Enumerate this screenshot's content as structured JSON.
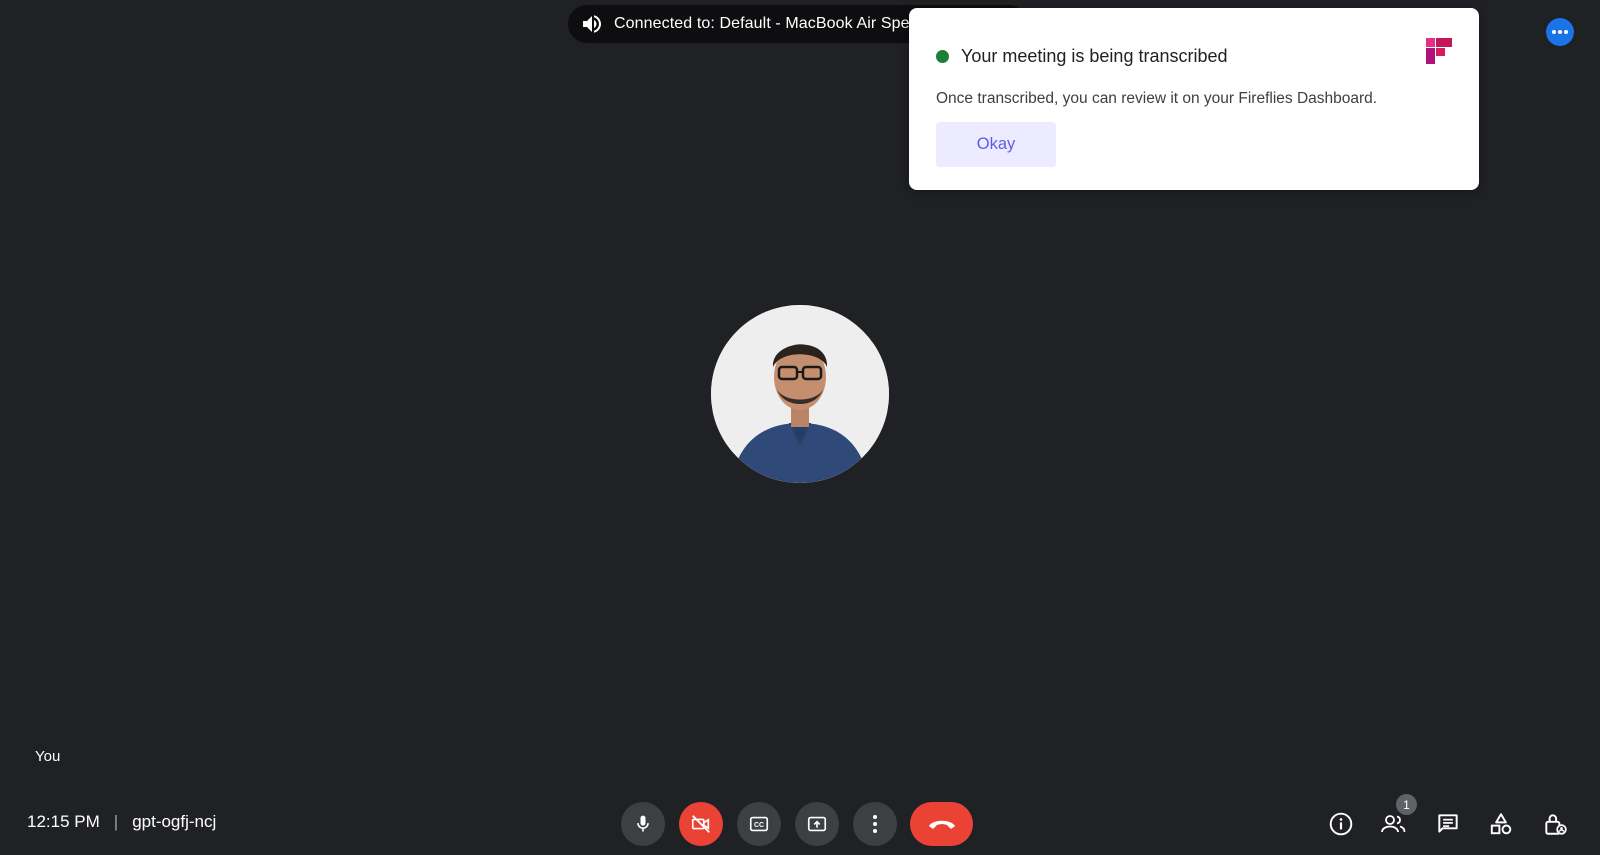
{
  "audio_banner": {
    "text": "Connected to: Default - MacBook Air Speakers"
  },
  "notification": {
    "title": "Your meeting is being transcribed",
    "body": "Once transcribed, you can review it on your Fireflies Dashboard.",
    "button_label": "Okay",
    "status_color": "#188038",
    "button_color": "#ecebff",
    "logo_icon": "fireflies-logo-icon"
  },
  "participant": {
    "label": "You",
    "avatar": "profile-photo"
  },
  "meeting": {
    "time": "12:15 PM",
    "separator": "|",
    "code": "gpt-ogfj-ncj"
  },
  "controls": {
    "mic": "microphone-icon",
    "camera": "camera-off-icon",
    "captions": "closed-captions-icon",
    "present": "present-screen-icon",
    "more": "more-vert-icon",
    "end": "end-call-icon"
  },
  "right_controls": {
    "people_count": "1"
  },
  "colors": {
    "background": "#202124",
    "red": "#ea4335",
    "blue": "#1a73e8"
  }
}
